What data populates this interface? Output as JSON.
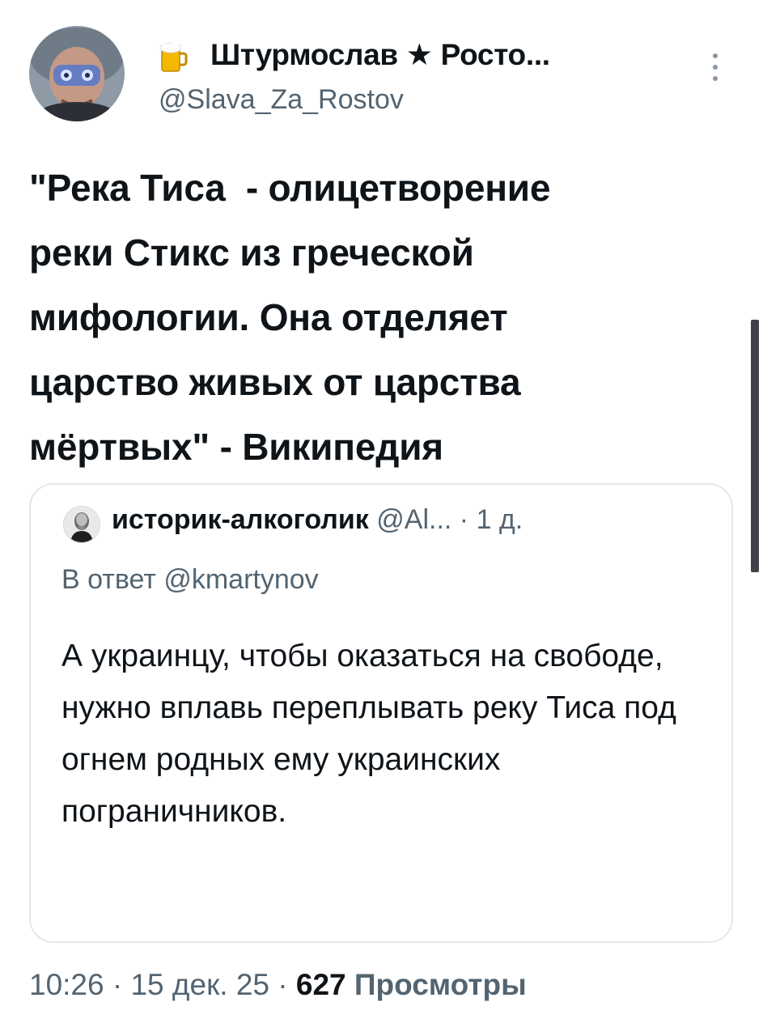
{
  "tweet": {
    "author_name": "Штурмослав ★ Росто...",
    "author_handle": "@Slava_Za_Rostov",
    "text": "\"Река Тиса  - олицетворение\nреки Стикс из греческой\nмифологии. Она отделяет\nцарство живых от царства\nмёртвых\" - Википедия"
  },
  "quoted": {
    "author_name": "историк-алкоголик",
    "author_handle": "@Al...",
    "time": "· 1 д.",
    "reply_to": "В ответ @kmartynov",
    "text": "А украинцу, чтобы оказаться на свободе, нужно вплавь переплывать реку Тиса под огнем родных ему украинских пограничников."
  },
  "meta": {
    "time": "10:26",
    "date": "15 дек. 25",
    "views_count": "627",
    "views_label": "Просмотры"
  },
  "icons": {
    "more": "more-vertical-icon",
    "beer": "beer-icon"
  },
  "colors": {
    "text": "#0f1419",
    "secondary": "#536471",
    "border": "#e1e8ed"
  }
}
